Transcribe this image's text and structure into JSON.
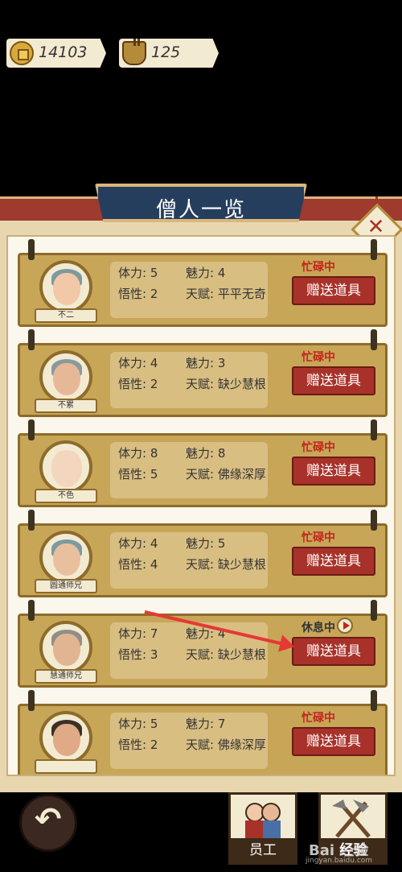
{
  "resources": {
    "coins": "14103",
    "incense": "125"
  },
  "window": {
    "title": "僧人一览",
    "close_icon": "close-icon"
  },
  "monks": [
    {
      "name": "不二",
      "stamina": "体力: 5",
      "charm": "魅力: 4",
      "wisdom": "悟性: 2",
      "talent": "天赋: 平平无奇",
      "status": "忙碌中",
      "gift": "赠送道具"
    },
    {
      "name": "不累",
      "stamina": "体力: 4",
      "charm": "魅力: 3",
      "wisdom": "悟性: 2",
      "talent": "天赋: 缺少慧根",
      "status": "忙碌中",
      "gift": "赠送道具"
    },
    {
      "name": "不色",
      "stamina": "体力: 8",
      "charm": "魅力: 8",
      "wisdom": "悟性: 5",
      "talent": "天赋: 佛缘深厚",
      "status": "忙碌中",
      "gift": "赠送道具"
    },
    {
      "name": "圆通师兄",
      "stamina": "体力: 4",
      "charm": "魅力: 5",
      "wisdom": "悟性: 4",
      "talent": "天赋: 缺少慧根",
      "status": "忙碌中",
      "gift": "赠送道具"
    },
    {
      "name": "慧通师兄",
      "stamina": "体力: 7",
      "charm": "魅力: 4",
      "wisdom": "悟性: 3",
      "talent": "天赋: 缺少慧根",
      "status": "休息中",
      "gift": "赠送道具"
    },
    {
      "name": "",
      "stamina": "体力: 5",
      "charm": "魅力: 7",
      "wisdom": "悟性: 2",
      "talent": "天赋: 佛缘深厚",
      "status": "忙碌中",
      "gift": "赠送道具"
    }
  ],
  "bottom": {
    "back_icon": "back-arrow-icon",
    "staff_label": "员工",
    "exp_label": "经验"
  },
  "watermark": {
    "brand": "Bai 经验",
    "url": "jingyan.baidu.com"
  },
  "colors": {
    "busy": "#c0261c",
    "gift_button": "#a8322a",
    "title_plate": "#263e5e",
    "band": "#9e3a2e"
  }
}
